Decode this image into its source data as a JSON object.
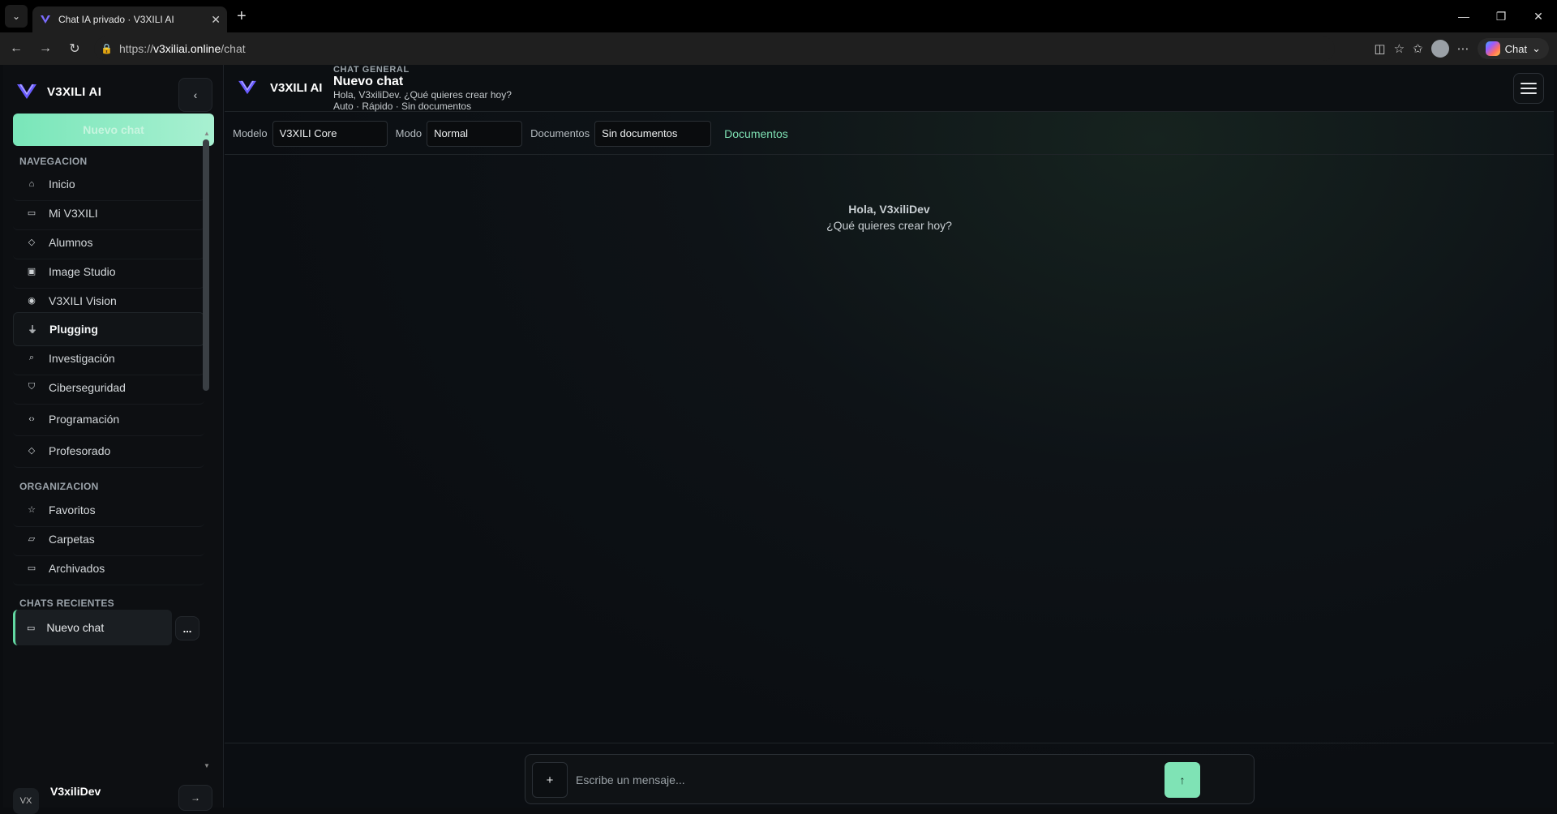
{
  "browser": {
    "tab_title": "Chat IA privado · V3XILI AI",
    "url_host": "v3xiliai.online",
    "url_prefix": "https://",
    "url_path": "/chat",
    "copilot_label": "Chat"
  },
  "sidebar": {
    "brand": "V3XILI AI",
    "collapse_icon": "‹",
    "new_chat": "Nuevo chat",
    "nav_title": "NAVEGACION",
    "nav_items": [
      {
        "label": "Inicio",
        "icon": "home-icon"
      },
      {
        "label": "Mi V3XILI",
        "icon": "chat-icon"
      },
      {
        "label": "Alumnos",
        "icon": "graduation-cap-icon"
      },
      {
        "label": "Image Studio",
        "icon": "image-icon"
      },
      {
        "label": "V3XILI Vision",
        "icon": "eye-icon"
      },
      {
        "label": "Plugging",
        "icon": "plug-icon"
      },
      {
        "label": "Investigación",
        "icon": "search-icon"
      },
      {
        "label": "Ciberseguridad",
        "icon": "shield-icon"
      },
      {
        "label": "Programación",
        "icon": "code-icon"
      },
      {
        "label": "Profesorado",
        "icon": "graduation-cap-icon"
      }
    ],
    "org_title": "ORGANIZACION",
    "org_items": [
      {
        "label": "Favoritos",
        "icon": "star-icon"
      },
      {
        "label": "Carpetas",
        "icon": "folder-icon"
      },
      {
        "label": "Archivados",
        "icon": "archive-icon"
      }
    ],
    "recent_title": "CHATS RECIENTES",
    "recent_items": [
      {
        "label": "Nuevo chat",
        "icon": "chat-icon"
      }
    ],
    "more_label": "...",
    "user": {
      "initials": "VX",
      "name": "V3xiliDev"
    }
  },
  "header": {
    "brand": "V3XILI AI",
    "kicker": "CHAT GENERAL",
    "title": "Nuevo chat",
    "subtitle": "Hola, V3xiliDev. ¿Qué quieres crear hoy?",
    "meta": "Auto · Rápido · Sin documentos"
  },
  "controls": {
    "model_label": "Modelo",
    "model_value": "V3XILI Core",
    "mode_label": "Modo",
    "mode_value": "Normal",
    "docs_label": "Documentos",
    "docs_value": "Sin documentos",
    "docs_link": "Documentos"
  },
  "greeting": {
    "line1": "Hola, V3xiliDev",
    "line2": "¿Qué quieres crear hoy?"
  },
  "composer": {
    "attach_label": "+",
    "placeholder": "Escribe un mensaje...",
    "send_label": "↑"
  },
  "colors": {
    "accent": "#7fe3b5",
    "background": "#0b0d10",
    "brand_purple": "#6a5cff"
  }
}
